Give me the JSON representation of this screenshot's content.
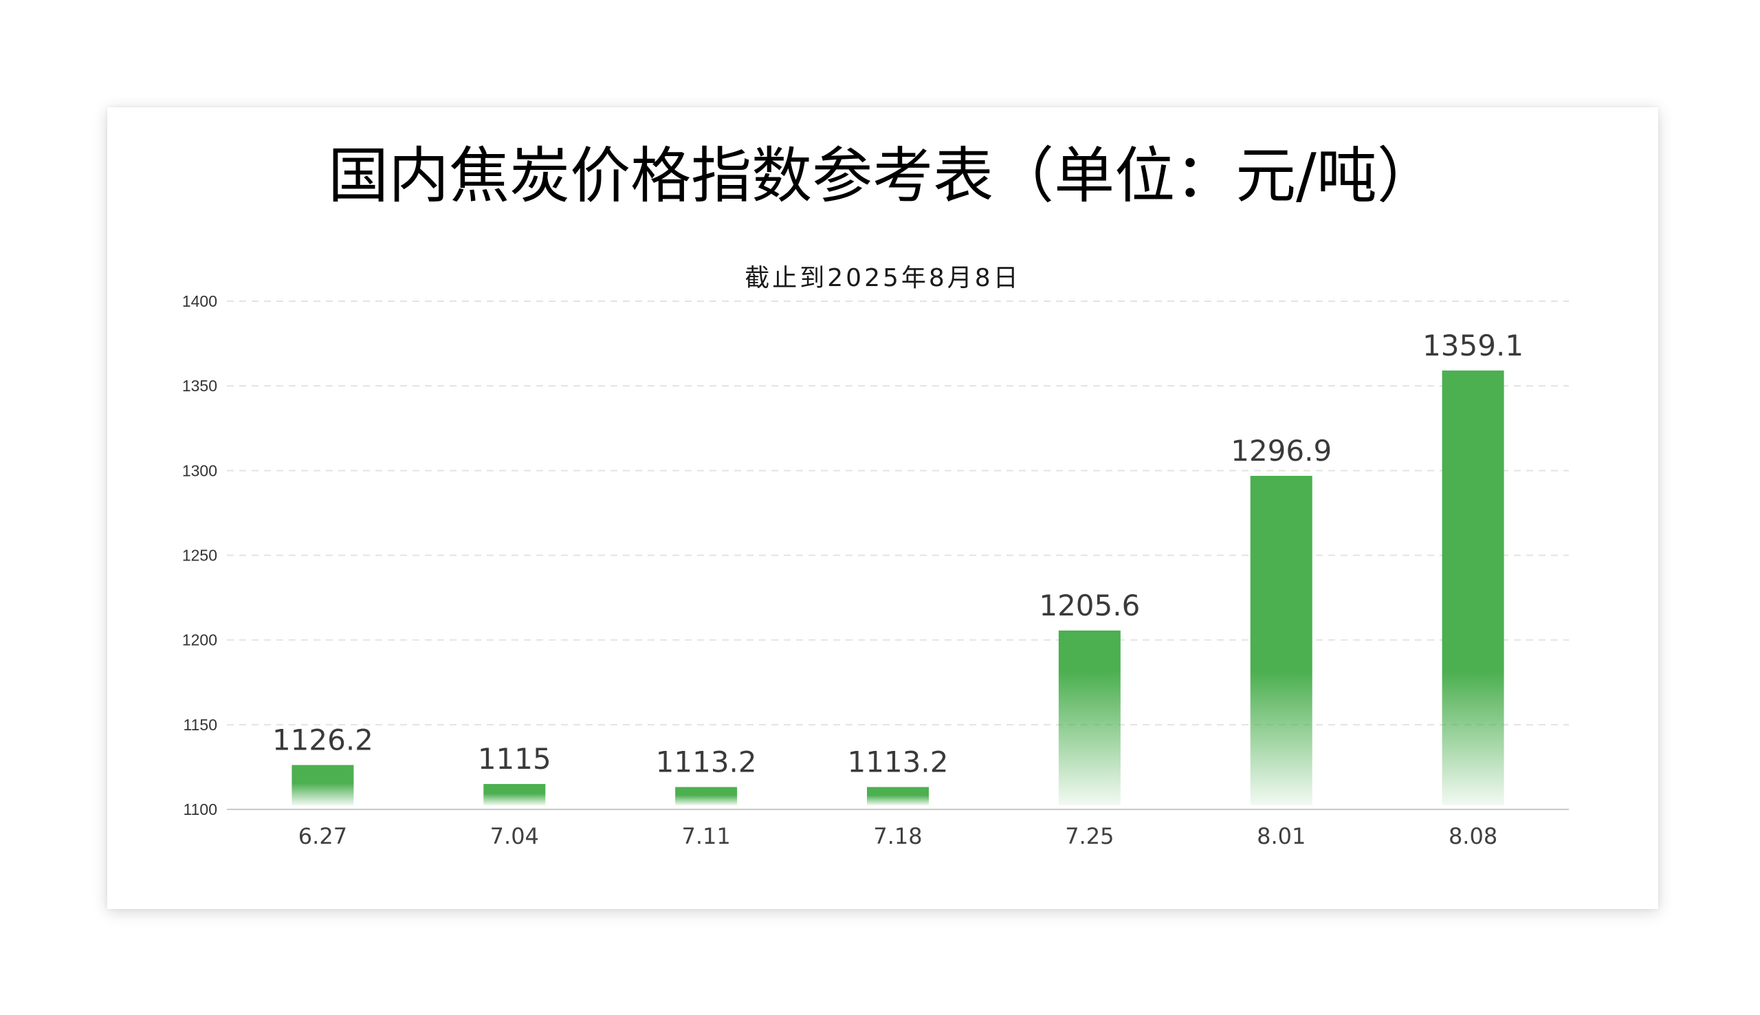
{
  "chart_data": {
    "type": "bar",
    "title": "国内焦炭价格指数参考表（单位：元/吨）",
    "subtitle": "截止到2025年8月8日",
    "xlabel": "",
    "ylabel": "",
    "categories": [
      "6.27",
      "7.04",
      "7.11",
      "7.18",
      "7.25",
      "8.01",
      "8.08"
    ],
    "values": [
      1126.2,
      1115,
      1113.2,
      1113.2,
      1205.6,
      1296.9,
      1359.1
    ],
    "data_labels": [
      "1126.2",
      "1115",
      "1113.2",
      "1113.2",
      "1205.6",
      "1296.9",
      "1359.1"
    ],
    "ylim": [
      1100,
      1400
    ],
    "yticks": [
      1100,
      1150,
      1200,
      1250,
      1300,
      1350,
      1400
    ],
    "grid": true,
    "legend": "none",
    "bar_color": "#4CAF50"
  }
}
